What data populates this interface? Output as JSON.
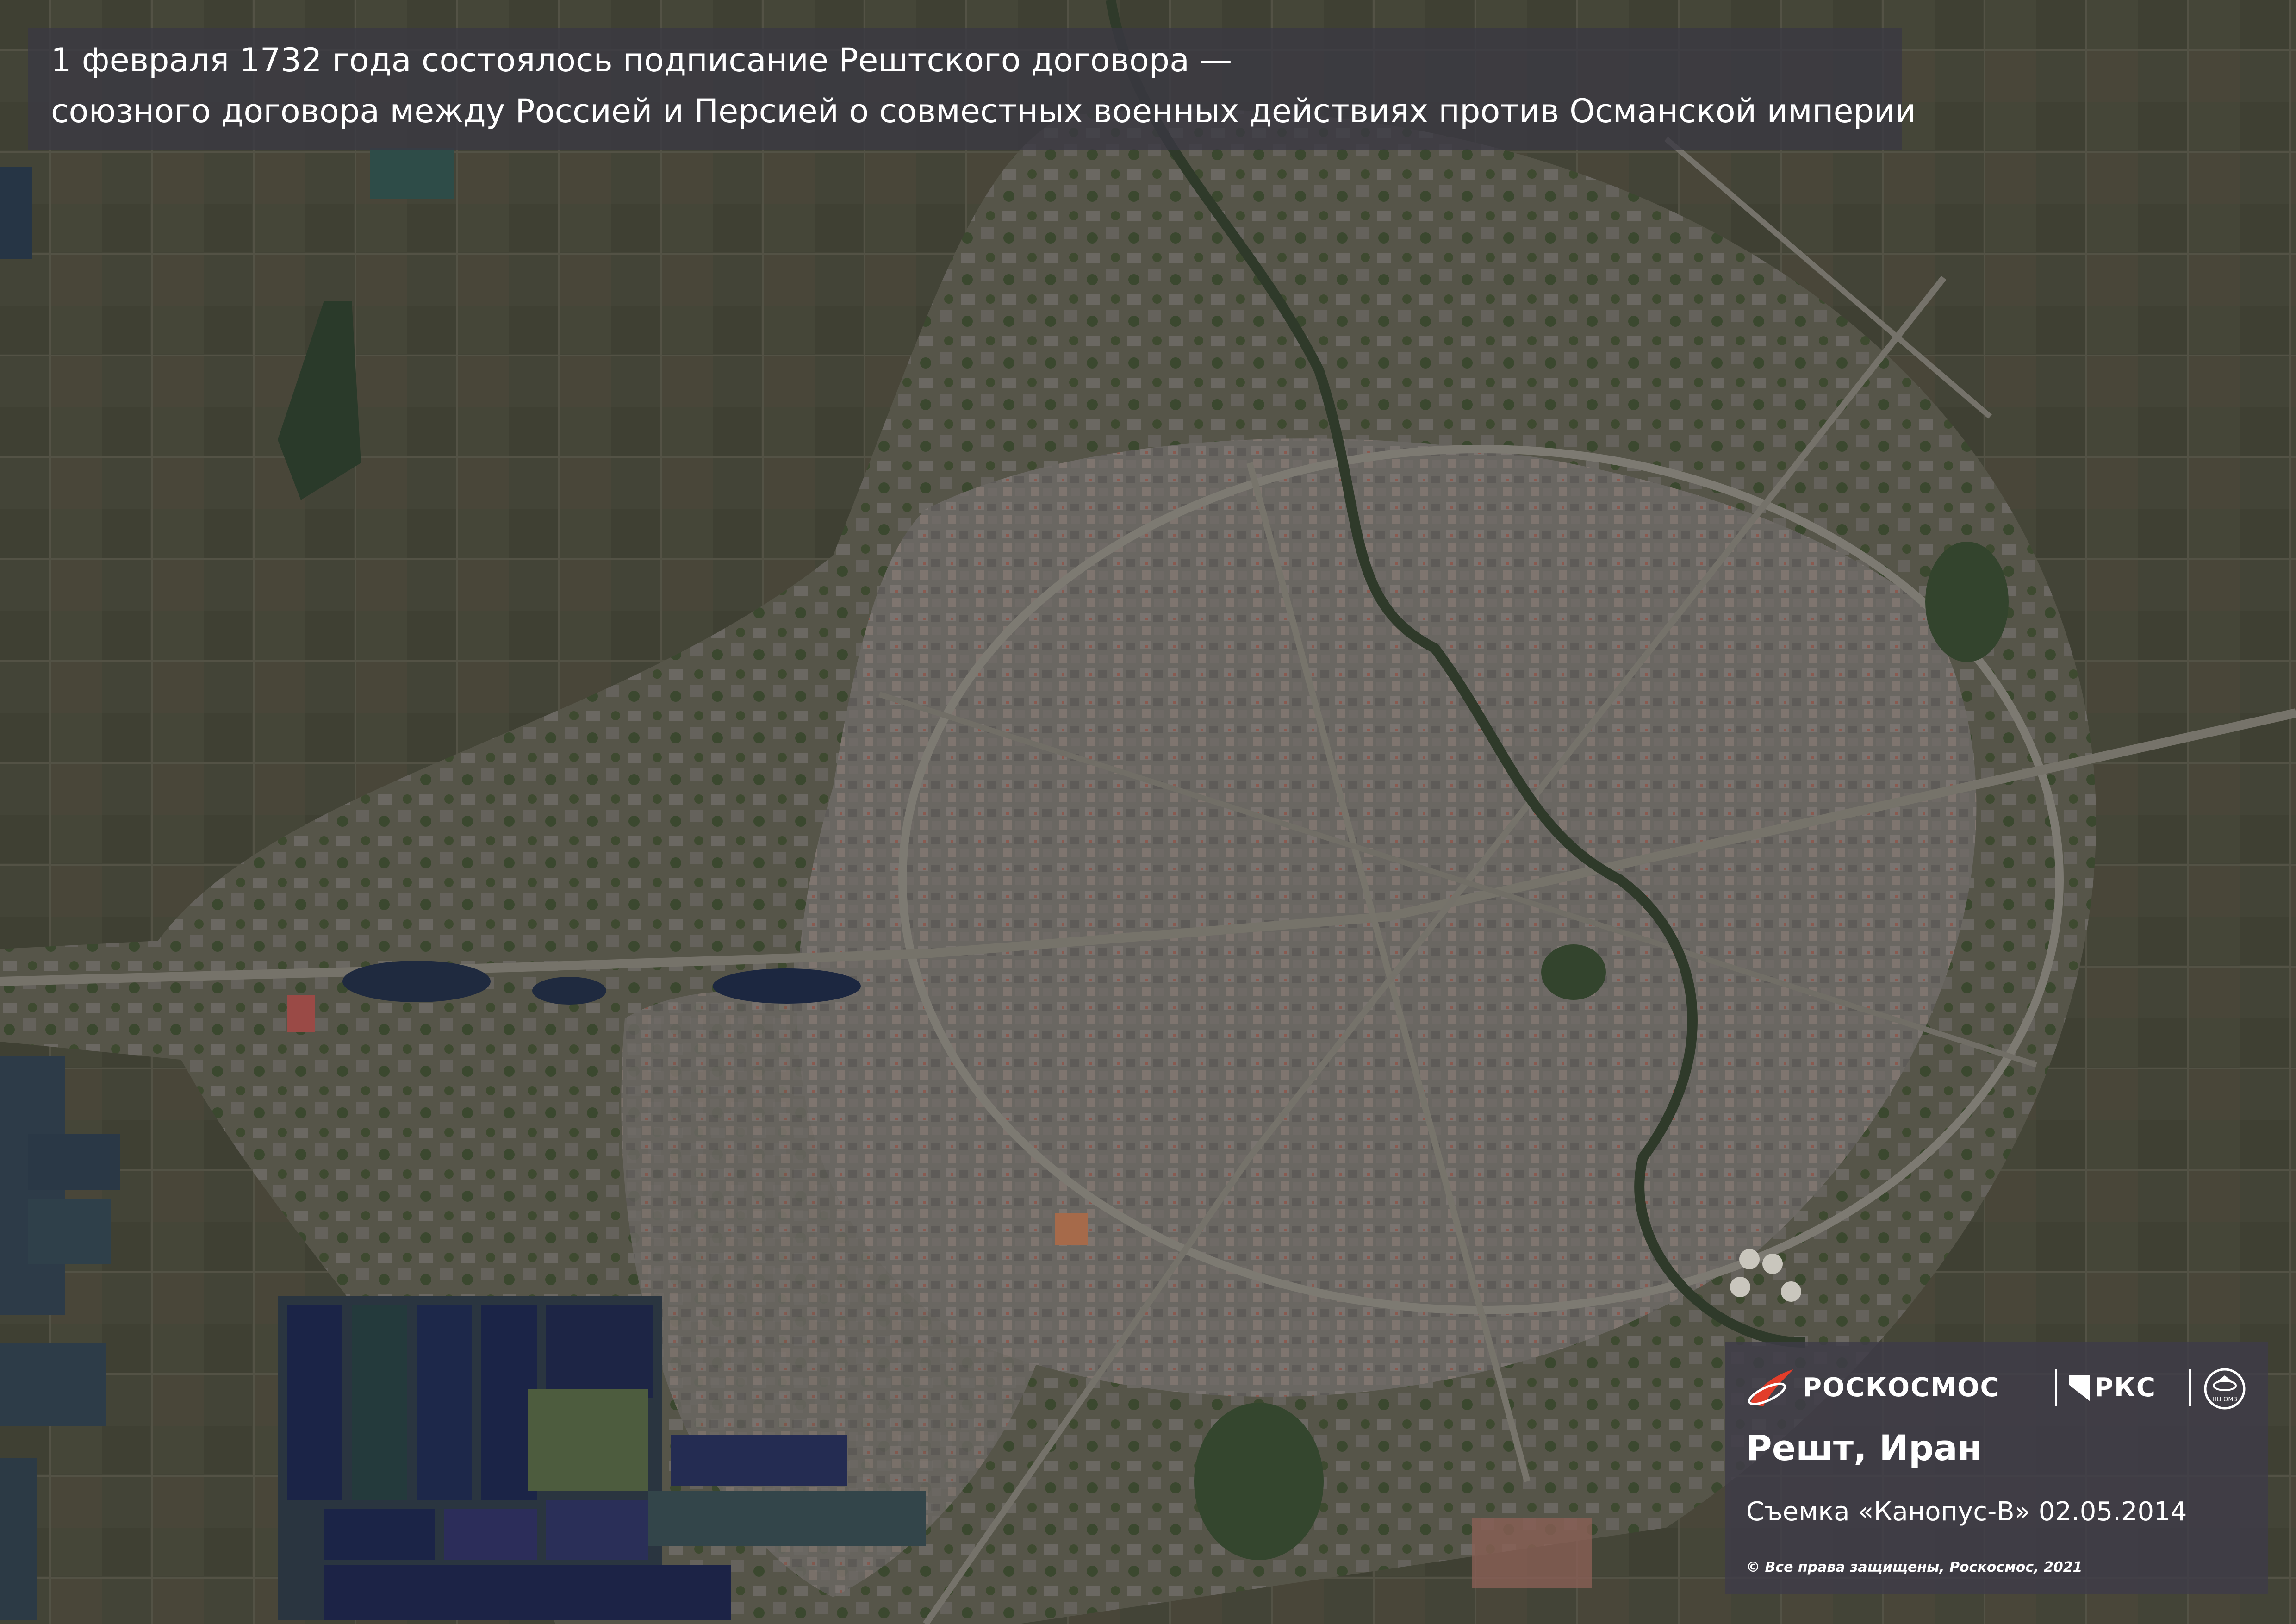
{
  "caption": {
    "line1": "1 февраля 1732 года состоялось подписание Рештского договора —",
    "line2": "союзного договора между Россией и Персией о совместных военных действиях против Османской империи"
  },
  "branding": {
    "roscosmos": "РОСКОСМОС",
    "rks": "РКС",
    "emblem_caption": "НЦ ОМЗ"
  },
  "location": "Решт, Иран",
  "survey": "Съемка «Канопус-В» 02.05.2014",
  "rights": "© Все права защищены, Роскосмос, 2021",
  "colors": {
    "farmland": "#4a4a3a",
    "urban": "#6b6660",
    "ponds": "#1e2a44",
    "panel": "#3e3c48",
    "text": "#ffffff"
  }
}
